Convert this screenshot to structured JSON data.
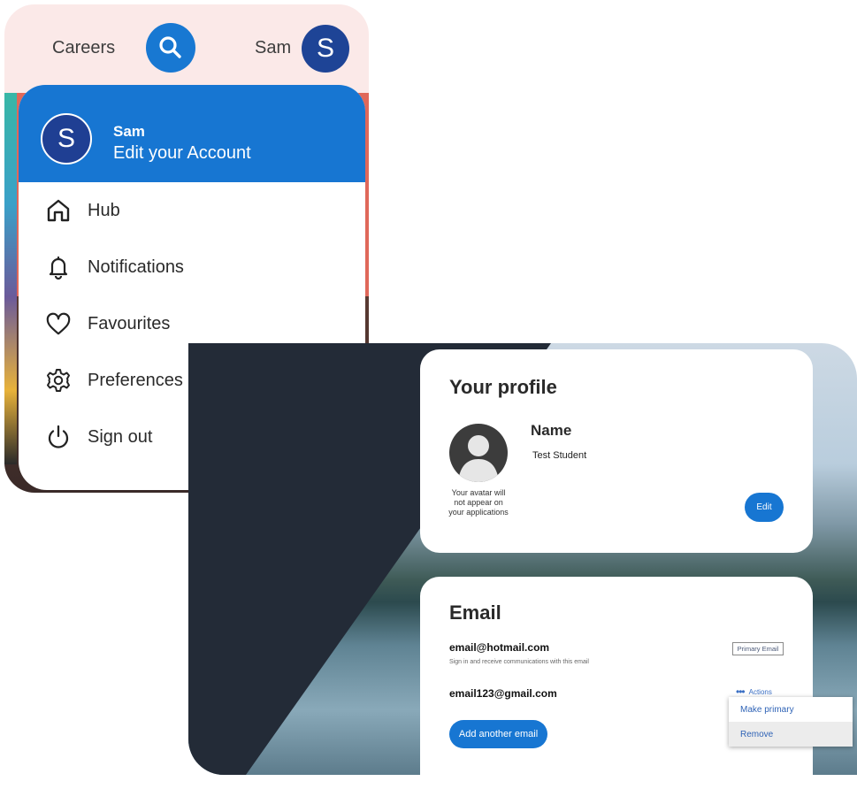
{
  "topbar": {
    "careers_label": "Careers",
    "username": "Sam",
    "avatar_initial": "S"
  },
  "account_menu": {
    "avatar_initial": "S",
    "name": "Sam",
    "subtitle": "Edit your Account",
    "items": [
      {
        "label": "Hub",
        "icon": "home-icon"
      },
      {
        "label": "Notifications",
        "icon": "bell-icon"
      },
      {
        "label": "Favourites",
        "icon": "heart-icon"
      },
      {
        "label": "Preferences",
        "icon": "gear-icon"
      },
      {
        "label": "Sign out",
        "icon": "power-icon"
      }
    ]
  },
  "profile": {
    "title": "Your profile",
    "avatar_note": "Your avatar will not appear on your applications",
    "name_label": "Name",
    "name_value": "Test Student",
    "edit_label": "Edit"
  },
  "email": {
    "title": "Email",
    "primary_address": "email@hotmail.com",
    "primary_hint": "Sign in and receive communications with this email",
    "primary_badge": "Primary Email",
    "secondary_address": "email123@gmail.com",
    "actions_label": "Actions",
    "add_label": "Add another email",
    "popup": [
      "Make primary",
      "Remove"
    ]
  },
  "colors": {
    "primary_blue": "#1776d2",
    "avatar_navy": "#1e4496"
  }
}
